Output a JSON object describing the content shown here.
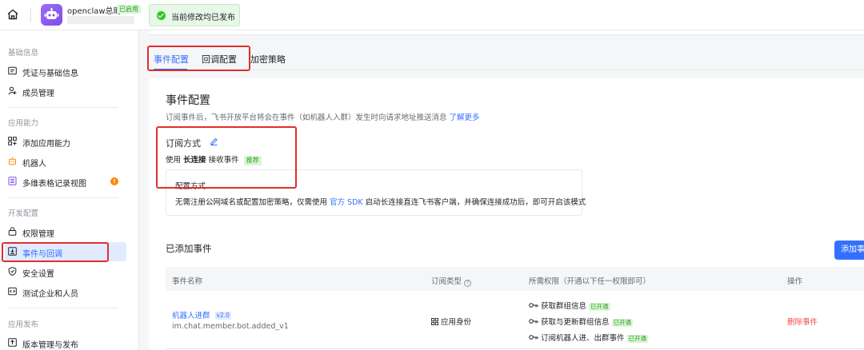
{
  "header": {
    "app_name": "openclaw总助",
    "app_status": "已启用",
    "toast": "当前修改均已发布"
  },
  "sidebar": {
    "sections": [
      {
        "title": "基础信息"
      },
      {
        "title": "应用能力"
      },
      {
        "title": "开发配置"
      },
      {
        "title": "应用发布"
      }
    ],
    "items": [
      {
        "label": "凭证与基础信息",
        "icon": "id-card-icon"
      },
      {
        "label": "成员管理",
        "icon": "user-add-icon"
      },
      {
        "label": "添加应用能力",
        "icon": "grid-add-icon"
      },
      {
        "label": "机器人",
        "icon": "robot-icon"
      },
      {
        "label": "多维表格记录视图",
        "icon": "table-view-icon",
        "badge": "!"
      },
      {
        "label": "权限管理",
        "icon": "lock-icon"
      },
      {
        "label": "事件与回调",
        "icon": "event-icon",
        "active": true
      },
      {
        "label": "安全设置",
        "icon": "shield-icon"
      },
      {
        "label": "测试企业和人员",
        "icon": "code-icon"
      },
      {
        "label": "版本管理与发布",
        "icon": "upload-icon"
      }
    ]
  },
  "tabs": [
    {
      "label": "事件配置",
      "active": true
    },
    {
      "label": "回调配置"
    },
    {
      "label": "加密策略"
    }
  ],
  "event_config": {
    "title": "事件配置",
    "desc": "订阅事件后，飞书开放平台将会在事件（如机器人入群）发生时向请求地址推送消息",
    "learn_more": "了解更多",
    "sub_title": "订阅方式",
    "use_prefix": "使用",
    "use_method": "长连接",
    "use_suffix": "接收事件",
    "recommend": "推荐",
    "cfg_title": "配置方式",
    "cfg_desc_a": "无需注册公网域名或配置加密策略，仅需使用",
    "cfg_sdk": "官方 SDK",
    "cfg_desc_b": "启动长连接直连飞书客户端，并确保连接成功后，即可开启该模式"
  },
  "added_events": {
    "title": "已添加事件",
    "add_button": "添加事件",
    "columns": [
      "事件名称",
      "订阅类型",
      "所需权限（开通以下任一权限即可）",
      "操作"
    ],
    "rows": [
      {
        "name": "机器人进群",
        "version": "v2.0",
        "code": "im.chat.member.bot.added_v1",
        "type": "应用身份",
        "permissions": [
          {
            "label": "获取群组信息",
            "status": "已开通"
          },
          {
            "label": "获取与更新群组信息",
            "status": "已开通"
          },
          {
            "label": "订阅机器人进、出群事件",
            "status": "已开通"
          }
        ],
        "action": "删除事件"
      }
    ]
  },
  "colors": {
    "accent": "#3370ff",
    "success": "#2ea121",
    "danger": "#f54a45",
    "annotation": "#e02e2e"
  }
}
